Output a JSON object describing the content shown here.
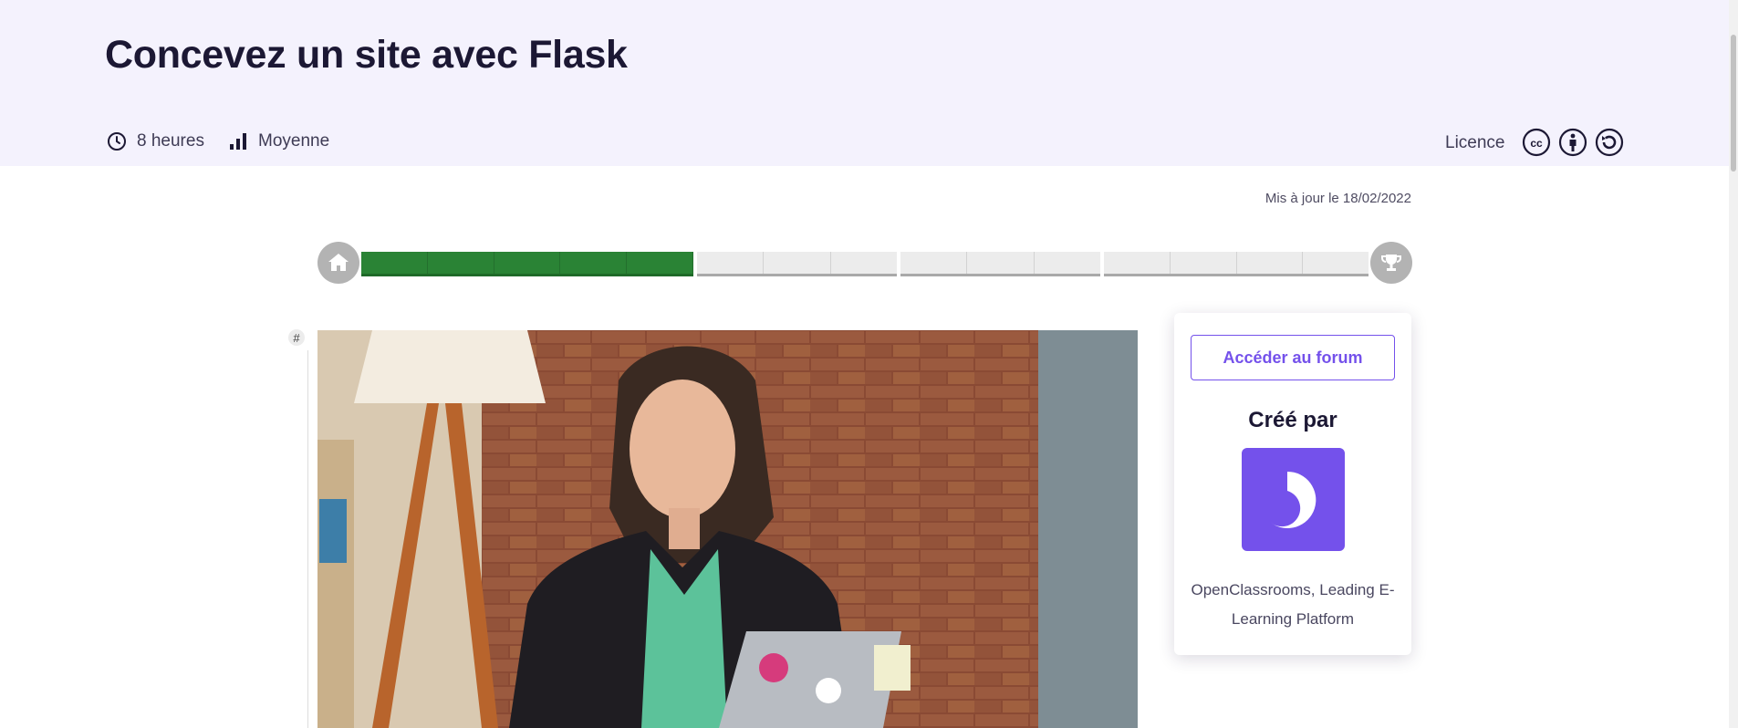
{
  "course": {
    "title": "Concevez un site avec Flask",
    "duration": "8 heures",
    "difficulty": "Moyenne",
    "licence_label": "Licence",
    "updated": "Mis à jour le 18/02/2022"
  },
  "progress": {
    "completed_fraction": 0.33,
    "parts": [
      {
        "cells": 5,
        "status": "done"
      },
      {
        "cells": 3,
        "status": "todo"
      },
      {
        "cells": 3,
        "status": "todo"
      },
      {
        "cells": 4,
        "status": "todo"
      }
    ]
  },
  "anchor": {
    "label": "#"
  },
  "sidebar": {
    "forum_button": "Accéder au forum",
    "created_by": "Créé par",
    "creator_name": "OpenClassrooms, Leading E-Learning Platform"
  },
  "icons": [
    "clock-icon",
    "bar-chart-icon",
    "cc-icon",
    "cc-by-icon",
    "cc-sa-icon",
    "home-icon",
    "trophy-icon",
    "openclassrooms-logo"
  ],
  "colors": {
    "header_bg": "#f4f2fd",
    "accent": "#7451eb",
    "progress_done": "#2a8335",
    "progress_todo": "#ececec",
    "node_gray": "#b3b3b3"
  }
}
